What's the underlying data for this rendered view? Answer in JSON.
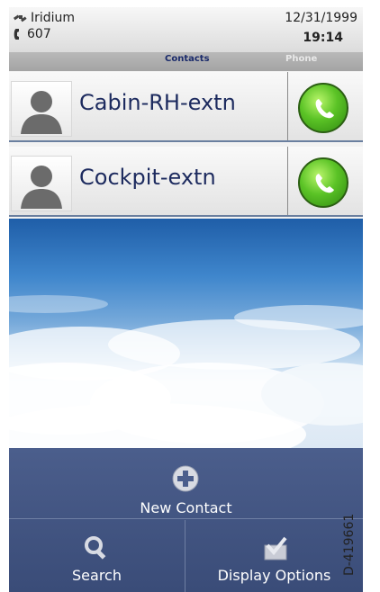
{
  "status": {
    "carrier": "Iridium",
    "extension": "607",
    "date": "12/31/1999",
    "time": "19:14"
  },
  "tabs": [
    {
      "label": "Contacts",
      "active": true
    },
    {
      "label": "Phone",
      "active": false
    }
  ],
  "contacts": [
    {
      "name": "Cabin-RH-extn"
    },
    {
      "name": "Cockpit-extn"
    }
  ],
  "menu": {
    "new_contact": "New Contact",
    "search": "Search",
    "display_options": "Display Options"
  },
  "figure_code": "D-419661",
  "colors": {
    "contact_text": "#1c2a5e",
    "menu_bg": "#4b5e8c",
    "call_green": "#5bc326"
  }
}
